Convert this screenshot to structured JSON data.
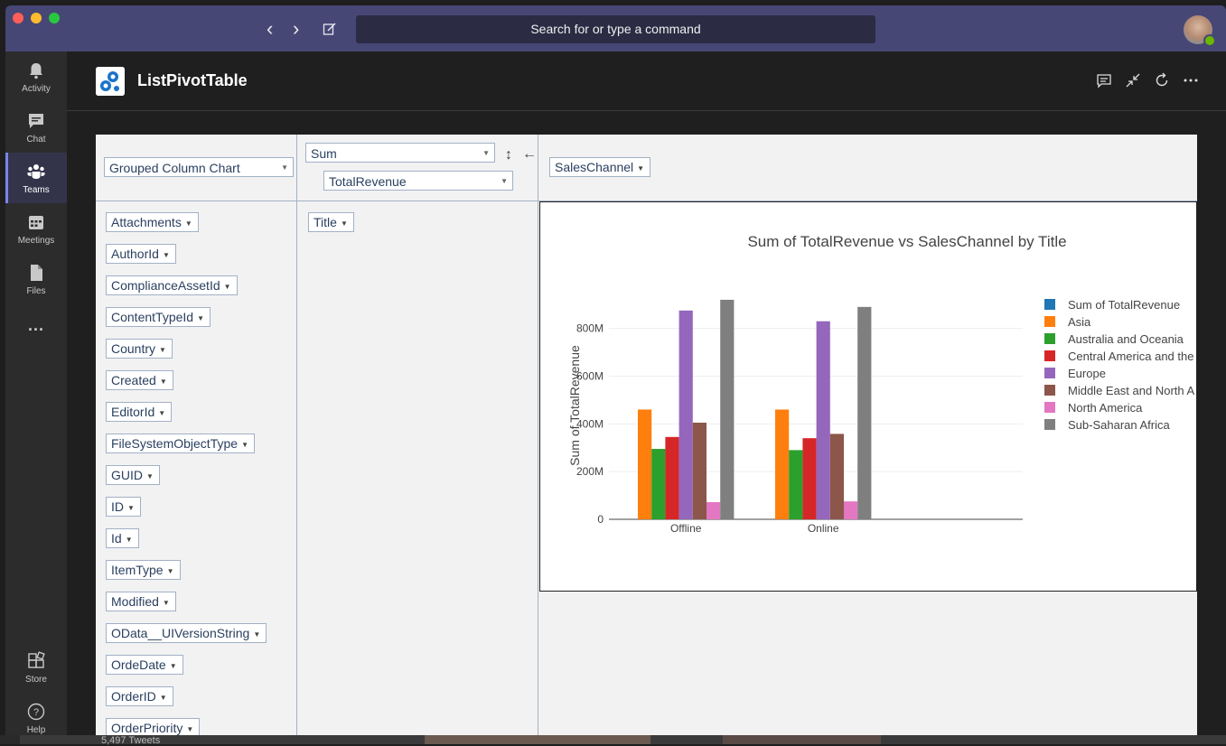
{
  "window": {
    "search_placeholder": "Search for or type a command"
  },
  "rail": {
    "items": [
      {
        "label": "Activity",
        "icon": "bell-icon"
      },
      {
        "label": "Chat",
        "icon": "chat-icon"
      },
      {
        "label": "Teams",
        "icon": "teams-icon",
        "active": true
      },
      {
        "label": "Meetings",
        "icon": "calendar-icon"
      },
      {
        "label": "Files",
        "icon": "file-icon"
      },
      {
        "label": "...",
        "icon": "more-icon"
      },
      {
        "label": "Store",
        "icon": "store-icon"
      },
      {
        "label": "Help",
        "icon": "help-icon"
      }
    ]
  },
  "app": {
    "title": "ListPivotTable"
  },
  "pivot": {
    "renderer": "Grouped Column Chart",
    "aggregator": "Sum",
    "aggregator_field": "TotalRevenue",
    "col_attr": "SalesChannel",
    "row_attr": "Title",
    "unused_attrs": [
      "Attachments",
      "AuthorId",
      "ComplianceAssetId",
      "ContentTypeId",
      "Country",
      "Created",
      "EditorId",
      "FileSystemObjectType",
      "GUID",
      "ID",
      "Id",
      "ItemType",
      "Modified",
      "OData__UIVersionString",
      "OrdeDate",
      "OrderID",
      "OrderPriority"
    ]
  },
  "footer_text": "5,497 Tweets",
  "chart_data": {
    "type": "bar",
    "title": "Sum of TotalRevenue vs SalesChannel by Title",
    "ylabel": "Sum of TotalRevenue",
    "xlabel": "",
    "categories": [
      "Offline",
      "Online"
    ],
    "ylim": [
      0,
      950000000
    ],
    "yticks": [
      "0",
      "200M",
      "400M",
      "600M",
      "800M"
    ],
    "yticks_values": [
      0,
      200000000,
      400000000,
      600000000,
      800000000
    ],
    "legend_position": "right",
    "grid": true,
    "legend_entries": [
      {
        "name": "Sum of TotalRevenue",
        "color": "#1f77b4"
      },
      {
        "name": "Asia",
        "color": "#ff7f0e"
      },
      {
        "name": "Australia and Oceania",
        "color": "#2ca02c"
      },
      {
        "name": "Central America and the",
        "color": "#d62728"
      },
      {
        "name": "Europe",
        "color": "#9467bd"
      },
      {
        "name": "Middle East and North A",
        "color": "#8c564b"
      },
      {
        "name": "North America",
        "color": "#e377c2"
      },
      {
        "name": "Sub-Saharan Africa",
        "color": "#7f7f7f"
      }
    ],
    "series": [
      {
        "name": "Asia",
        "color": "#ff7f0e",
        "values": [
          460000000,
          460000000
        ]
      },
      {
        "name": "Australia and Oceania",
        "color": "#2ca02c",
        "values": [
          295000000,
          290000000
        ]
      },
      {
        "name": "Central America and the",
        "color": "#d62728",
        "values": [
          345000000,
          340000000
        ]
      },
      {
        "name": "Europe",
        "color": "#9467bd",
        "values": [
          875000000,
          830000000
        ]
      },
      {
        "name": "Middle East and North A",
        "color": "#8c564b",
        "values": [
          405000000,
          358000000
        ]
      },
      {
        "name": "North America",
        "color": "#e377c2",
        "values": [
          72000000,
          75000000
        ]
      },
      {
        "name": "Sub-Saharan Africa",
        "color": "#7f7f7f",
        "values": [
          920000000,
          890000000
        ]
      }
    ]
  }
}
